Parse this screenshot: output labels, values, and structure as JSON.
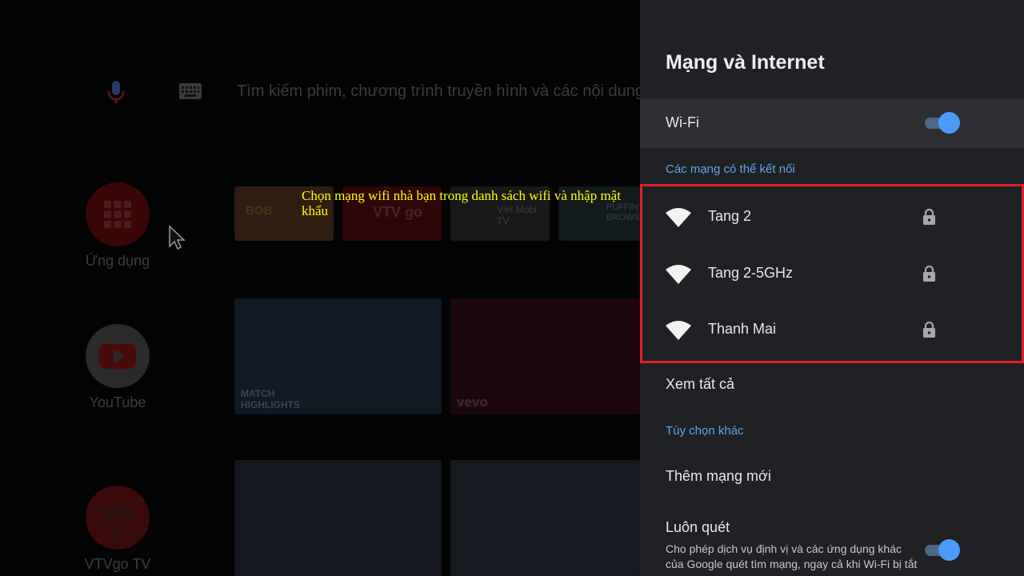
{
  "background": {
    "search_placeholder": "Tìm kiếm phim, chương trình truyền hình và các nội dung",
    "apps": [
      {
        "label": "Ứng dụng",
        "icon": "apps-grid-icon"
      },
      {
        "label": "YouTube",
        "icon": "youtube-icon"
      },
      {
        "label": "VTVgo TV",
        "icon": "vtvgo-icon"
      }
    ],
    "tiles": {
      "row1": [
        "BOB",
        "VTV go",
        "Viet Mobi TV",
        "PUFFIN BROWSER"
      ],
      "row2": [
        "MATCH HIGHLIGHTS",
        "vevo"
      ]
    },
    "annotation": "Chọn mạng wifi nhà bạn trong danh sách wifi và nhập mật khẩu"
  },
  "panel": {
    "title": "Mạng và Internet",
    "wifi_label": "Wi-Fi",
    "wifi_enabled": true,
    "available_header": "Các mạng có thể kết nối",
    "networks": [
      {
        "name": "Tang 2",
        "secured": true
      },
      {
        "name": "Tang 2-5GHz",
        "secured": true
      },
      {
        "name": "Thanh Mai",
        "secured": true
      }
    ],
    "see_all": "Xem tất cả",
    "other_header": "Tùy chọn khác",
    "add_network": "Thêm mạng mới",
    "always_scan": {
      "label": "Luôn quét",
      "description": "Cho phép dịch vụ định vị và các ứng dụng khác của Google quét tìm mạng, ngay cả khi Wi-Fi bị tắt",
      "enabled": true
    }
  },
  "colors": {
    "accent": "#4b9bf7",
    "section_header": "#5ea6ee",
    "highlight_border": "#e0202d",
    "annotation_text": "#ffff00"
  }
}
